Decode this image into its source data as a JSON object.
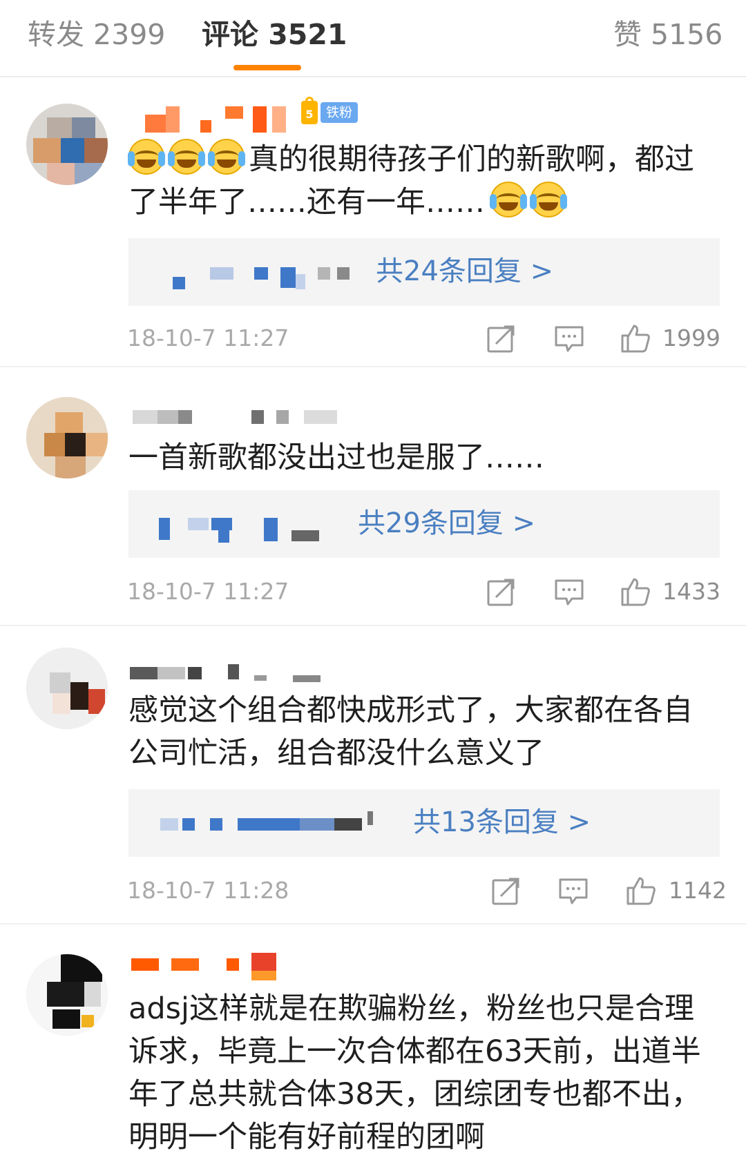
{
  "tabs": {
    "repost": "转发 2399",
    "comment": "评论 3521",
    "like": "赞 5156"
  },
  "colors": {
    "accent": "#ff8200",
    "link": "#4a7fc1",
    "badge": "#6aa8f0"
  },
  "comments": [
    {
      "badge": "铁粉",
      "text_line1": "真的很期待孩子们的新歌啊，都过",
      "text_line2": "了半年了……还有一年……",
      "replies": "共24条回复 >",
      "time": "18-10-7 11:27",
      "likes": "1999"
    },
    {
      "text": "一首新歌都没出过也是服了……",
      "replies": "共29条回复 >",
      "time": "18-10-7 11:27",
      "likes": "1433"
    },
    {
      "text_line1": "感觉这个组合都快成形式了，大家都在各自",
      "text_line2": "公司忙活，组合都没什么意义了",
      "replies": "共13条回复 >",
      "time": "18-10-7 11:28",
      "likes": "1142"
    },
    {
      "text_line1": "adsj这样就是在欺骗粉丝，粉丝也只是合理",
      "text_line2": "诉求，毕竟上一次合体都在63天前，出道半",
      "text_line3": "年了总共就合体38天，团综团专也都不出，",
      "text_line4": "明明一个能有好前程的团啊"
    }
  ],
  "icons": {
    "share": "share-icon",
    "reply": "comment-icon",
    "like": "thumbs-up-icon"
  }
}
